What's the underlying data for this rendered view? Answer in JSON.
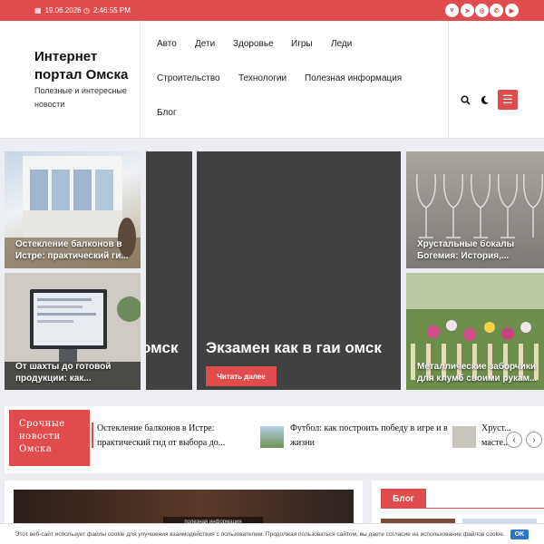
{
  "topbar": {
    "date": "19.06.2026",
    "time": "2:46:55 PM",
    "social_icons": [
      "vk-icon",
      "telegram-icon",
      "odnoklassniki-icon",
      "whatsapp-icon",
      "youtube-icon"
    ]
  },
  "header": {
    "site_title": "Интернет портал Омска",
    "site_desc": "Полезные и интересные новости",
    "nav": [
      "Авто",
      "Дети",
      "Здоровье",
      "Игры",
      "Леди",
      "Строительство",
      "Технологии",
      "Полезная информация",
      "Блог"
    ]
  },
  "slider": {
    "tiles": [
      {
        "caption": "Остекление балконов в Истре: практический ги..."
      },
      {
        "caption": "От шахты до готовой продукции: как..."
      },
      {
        "caption": "Хрустальные бокалы Богемия: История,..."
      },
      {
        "caption": "Металлические заборчики для клумб своими рукам..."
      }
    ],
    "partial_title": "омск",
    "main_title": "Экзамен как в гаи омск",
    "read_more": "Читать далее"
  },
  "ticker": {
    "label": "Срочные новости Омска",
    "items": [
      "Остекление балконов в Истре: практический гид от выбора до...",
      "Футбол: как построить победу в игре и в жизни",
      "Хруст... масте..."
    ]
  },
  "lower": {
    "blog_label": "Блог",
    "card_category": "полезная информация"
  },
  "cookie": {
    "text": "Этот веб-сайт использует файлы cookie для улучшения взаимодействия с пользователем. Продолжая пользоваться сайтом, вы даете согласие на использование файлов cookie.",
    "ok": "OK"
  },
  "colors": {
    "accent": "#e04b4b",
    "ok_button": "#2a77c5"
  }
}
